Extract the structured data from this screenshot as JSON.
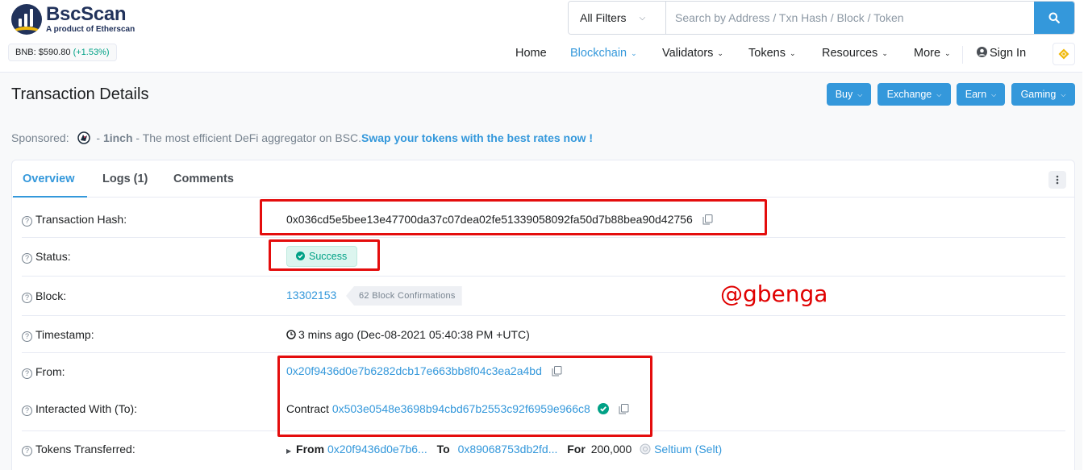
{
  "header": {
    "logo_title": "BscScan",
    "logo_sub": "A product of Etherscan",
    "price_label": "BNB: $590.80",
    "price_change": "(+1.53%)",
    "filter_label": "All Filters",
    "search_placeholder": "Search by Address / Txn Hash / Block / Token",
    "nav": [
      "Home",
      "Blockchain",
      "Validators",
      "Tokens",
      "Resources",
      "More",
      "Sign In"
    ]
  },
  "page": {
    "title": "Transaction Details",
    "buttons": [
      "Buy",
      "Exchange",
      "Earn",
      "Gaming"
    ],
    "sponsored_label": "Sponsored:",
    "sponsor_brand": "1inch",
    "sponsor_text": " - The most efficient DeFi aggregator on BSC.",
    "sponsor_cta": "Swap your tokens with the best rates now !"
  },
  "tabs": [
    "Overview",
    "Logs (1)",
    "Comments"
  ],
  "details": {
    "hash_label": "Transaction Hash:",
    "hash": "0x036cd5e5bee13e47700da37c07dea02fe51339058092fa50d7b88bea90d42756",
    "status_label": "Status:",
    "status": "Success",
    "block_label": "Block:",
    "block": "13302153",
    "confirmations": "62 Block Confirmations",
    "timestamp_label": "Timestamp:",
    "timestamp": "3 mins ago (Dec-08-2021 05:40:38 PM +UTC)",
    "from_label": "From:",
    "from": "0x20f9436d0e7b6282dcb17e663bb8f04c3ea2a4bd",
    "to_label": "Interacted With (To):",
    "to_prefix": "Contract",
    "to": "0x503e0548e3698b94cbd67b2553c92f6959e966c8",
    "tokens_label": "Tokens Transferred:",
    "tt_from_label": "From",
    "tt_from": "0x20f9436d0e7b6...",
    "tt_to_label": "To",
    "tt_to": "0x89068753db2fd...",
    "tt_for_label": "For",
    "tt_amount": "200,000",
    "tt_token": "Seltium (Selt)"
  },
  "watermark": "@gbenga",
  "colors": {
    "accent": "#3498db",
    "success": "#00a186",
    "annotation": "#e40d0d",
    "brand": "#21325b"
  }
}
